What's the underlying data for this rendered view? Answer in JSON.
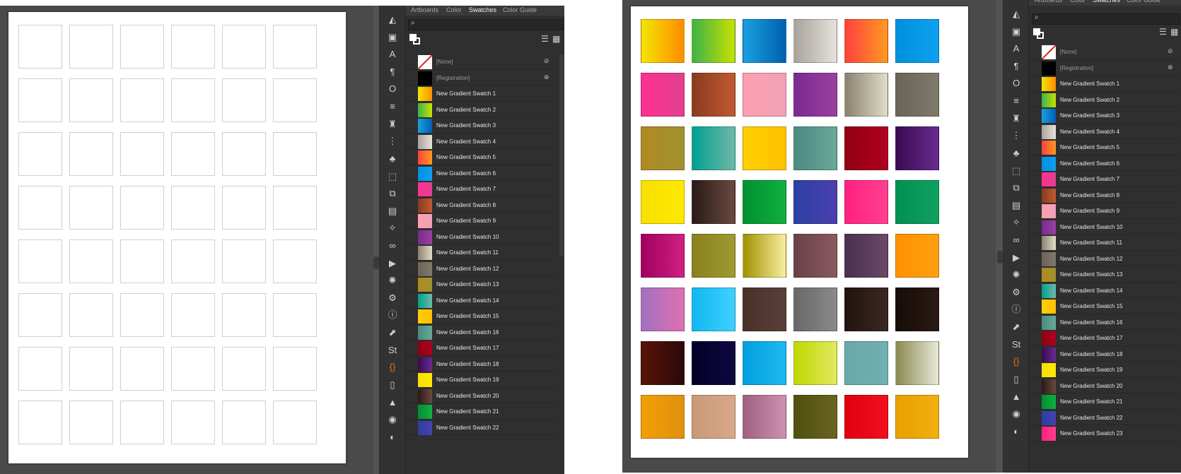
{
  "tabs": [
    "Artboards",
    "Color",
    "Swatches",
    "Color Guide"
  ],
  "active_tab": "Swatches",
  "left_view": {
    "artboard_label": "Empty swatch grid",
    "visible_rows": 24
  },
  "right_view": {
    "artboard_label": "Gradient swatch grid",
    "visible_rows": 25
  },
  "swatch_rows": [
    {
      "label": "[None]",
      "kind": "none",
      "icon": "⊘"
    },
    {
      "label": "[Registration]",
      "kind": "registration",
      "icon": "⊕"
    },
    {
      "label": "New Gradient Swatch 1",
      "kind": "gradient"
    },
    {
      "label": "New Gradient Swatch 2",
      "kind": "gradient"
    },
    {
      "label": "New Gradient Swatch 3",
      "kind": "gradient"
    },
    {
      "label": "New Gradient Swatch 4",
      "kind": "gradient"
    },
    {
      "label": "New Gradient Swatch 5",
      "kind": "gradient"
    },
    {
      "label": "New Gradient Swatch 6",
      "kind": "gradient"
    },
    {
      "label": "New Gradient Swatch 7",
      "kind": "gradient"
    },
    {
      "label": "New Gradient Swatch 8",
      "kind": "gradient"
    },
    {
      "label": "New Gradient Swatch 9",
      "kind": "gradient"
    },
    {
      "label": "New Gradient Swatch 10",
      "kind": "gradient"
    },
    {
      "label": "New Gradient Swatch 11",
      "kind": "gradient"
    },
    {
      "label": "New Gradient Swatch 12",
      "kind": "gradient"
    },
    {
      "label": "New Gradient Swatch 13",
      "kind": "gradient"
    },
    {
      "label": "New Gradient Swatch 14",
      "kind": "gradient"
    },
    {
      "label": "New Gradient Swatch 15",
      "kind": "gradient"
    },
    {
      "label": "New Gradient Swatch 16",
      "kind": "gradient"
    },
    {
      "label": "New Gradient Swatch 17",
      "kind": "gradient"
    },
    {
      "label": "New Gradient Swatch 18",
      "kind": "gradient"
    },
    {
      "label": "New Gradient Swatch 19",
      "kind": "gradient"
    },
    {
      "label": "New Gradient Swatch 20",
      "kind": "gradient"
    },
    {
      "label": "New Gradient Swatch 21",
      "kind": "gradient"
    },
    {
      "label": "New Gradient Swatch 22",
      "kind": "gradient"
    },
    {
      "label": "New Gradient Swatch 23",
      "kind": "gradient"
    }
  ],
  "gradients": [
    [
      "#f2e600",
      "#ff8c00"
    ],
    [
      "#3cb44a",
      "#c8e000"
    ],
    [
      "#1aa0e0",
      "#0060b0"
    ],
    [
      "#a8a49c",
      "#e6e2dc"
    ],
    [
      "#ff4040",
      "#ff9a20"
    ],
    [
      "#0090e0",
      "#10a0f0"
    ],
    [
      "#ff3090",
      "#e04090"
    ],
    [
      "#8a3a20",
      "#c05a30"
    ],
    [
      "#ff9fb0",
      "#f0a0b8"
    ],
    [
      "#7a2a90",
      "#9a40a0"
    ],
    [
      "#8a8270",
      "#e0dcc8"
    ],
    [
      "#6a6458",
      "#807a6c"
    ],
    [
      "#b08a20",
      "#a09030"
    ],
    [
      "#00a090",
      "#70b8a8"
    ],
    [
      "#ffd000",
      "#ffc000"
    ],
    [
      "#4a8a80",
      "#6aa898"
    ],
    [
      "#900010",
      "#b00020"
    ],
    [
      "#3a0a50",
      "#6a2a90"
    ],
    [
      "#f8e000",
      "#ffe800"
    ],
    [
      "#2a1a18",
      "#6a4a40"
    ],
    [
      "#009030",
      "#10b040"
    ],
    [
      "#2a40a0",
      "#4a40b0"
    ],
    [
      "#ff2080",
      "#ff4090"
    ],
    [
      "#009050",
      "#10a060"
    ],
    [
      "#a00060",
      "#d02080"
    ],
    [
      "#8a8020",
      "#a09a30"
    ],
    [
      "#a09000",
      "#f8f0a0"
    ],
    [
      "#6a4048",
      "#8a5a60"
    ],
    [
      "#4a3050",
      "#6a4a68"
    ],
    [
      "#ff9000",
      "#ffa010"
    ],
    [
      "#a070c0",
      "#e070b0"
    ],
    [
      "#10b8f0",
      "#40d0ff"
    ],
    [
      "#4a3028",
      "#5a4038"
    ],
    [
      "#686868",
      "#8a8a8a"
    ],
    [
      "#201410",
      "#3a2820"
    ],
    [
      "#180c08",
      "#281a14"
    ],
    [
      "#5a1408",
      "#2a0808"
    ],
    [
      "#000028",
      "#100840"
    ],
    [
      "#00a0e0",
      "#20b8f0"
    ],
    [
      "#c0d800",
      "#e0e860"
    ],
    [
      "#68a8a8",
      "#70b0b0"
    ],
    [
      "#8a8a50",
      "#e8e8d8"
    ],
    [
      "#f0a000",
      "#e09010"
    ],
    [
      "#c89a78",
      "#d8a888"
    ],
    [
      "#a06080",
      "#d090b0"
    ],
    [
      "#505010",
      "#6a6420"
    ],
    [
      "#e00010",
      "#f01020"
    ],
    [
      "#e8a000",
      "#f0b010"
    ]
  ],
  "colors": {
    "panel_bg": "#2f2f2f",
    "tab_bar": "#3a3a3a",
    "workspace": "#535353",
    "none_slash": "#e02020"
  },
  "tool_icons": [
    "chart-icon",
    "image-icon",
    "character-icon",
    "paragraph-icon",
    "opentype-icon",
    "stroke-icon",
    "puppet-icon",
    "distribute-icon",
    "symbol-icon",
    "transform-icon",
    "pathfinder-icon",
    "align-icon",
    "magic-wand-icon",
    "links-icon",
    "actions-icon",
    "brushes-icon",
    "settings-icon",
    "info-icon",
    "export-icon",
    "stock-icon",
    "cc-libraries-icon",
    "document-icon",
    "layers-icon",
    "graphic-styles-icon",
    "appearance-icon"
  ]
}
